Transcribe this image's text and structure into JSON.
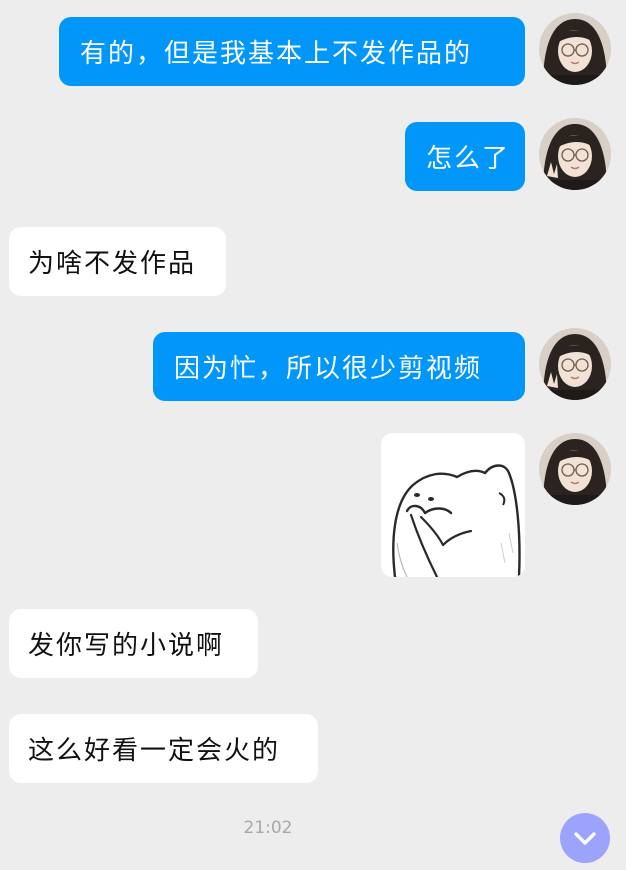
{
  "conversation": {
    "messages": [
      {
        "sender": "me",
        "text": "有的，但是我基本上不发作品的"
      },
      {
        "sender": "me",
        "text": "怎么了"
      },
      {
        "sender": "other",
        "text": "为啥不发作品"
      },
      {
        "sender": "me",
        "text": "因为忙，所以很少剪视频"
      },
      {
        "sender": "me",
        "sticker": "shy-blob-cover-mouth"
      },
      {
        "sender": "other",
        "text": "发你写的小说啊"
      },
      {
        "sender": "other",
        "text": "这么好看一定会火的"
      }
    ],
    "timestamp": "21:02"
  },
  "colors": {
    "sent_bubble": "#0096fa",
    "received_bubble": "#ffffff",
    "background": "#ededed",
    "scroll_button": "#9099ff"
  },
  "icons": {
    "scroll_down": "chevron-down-icon"
  }
}
